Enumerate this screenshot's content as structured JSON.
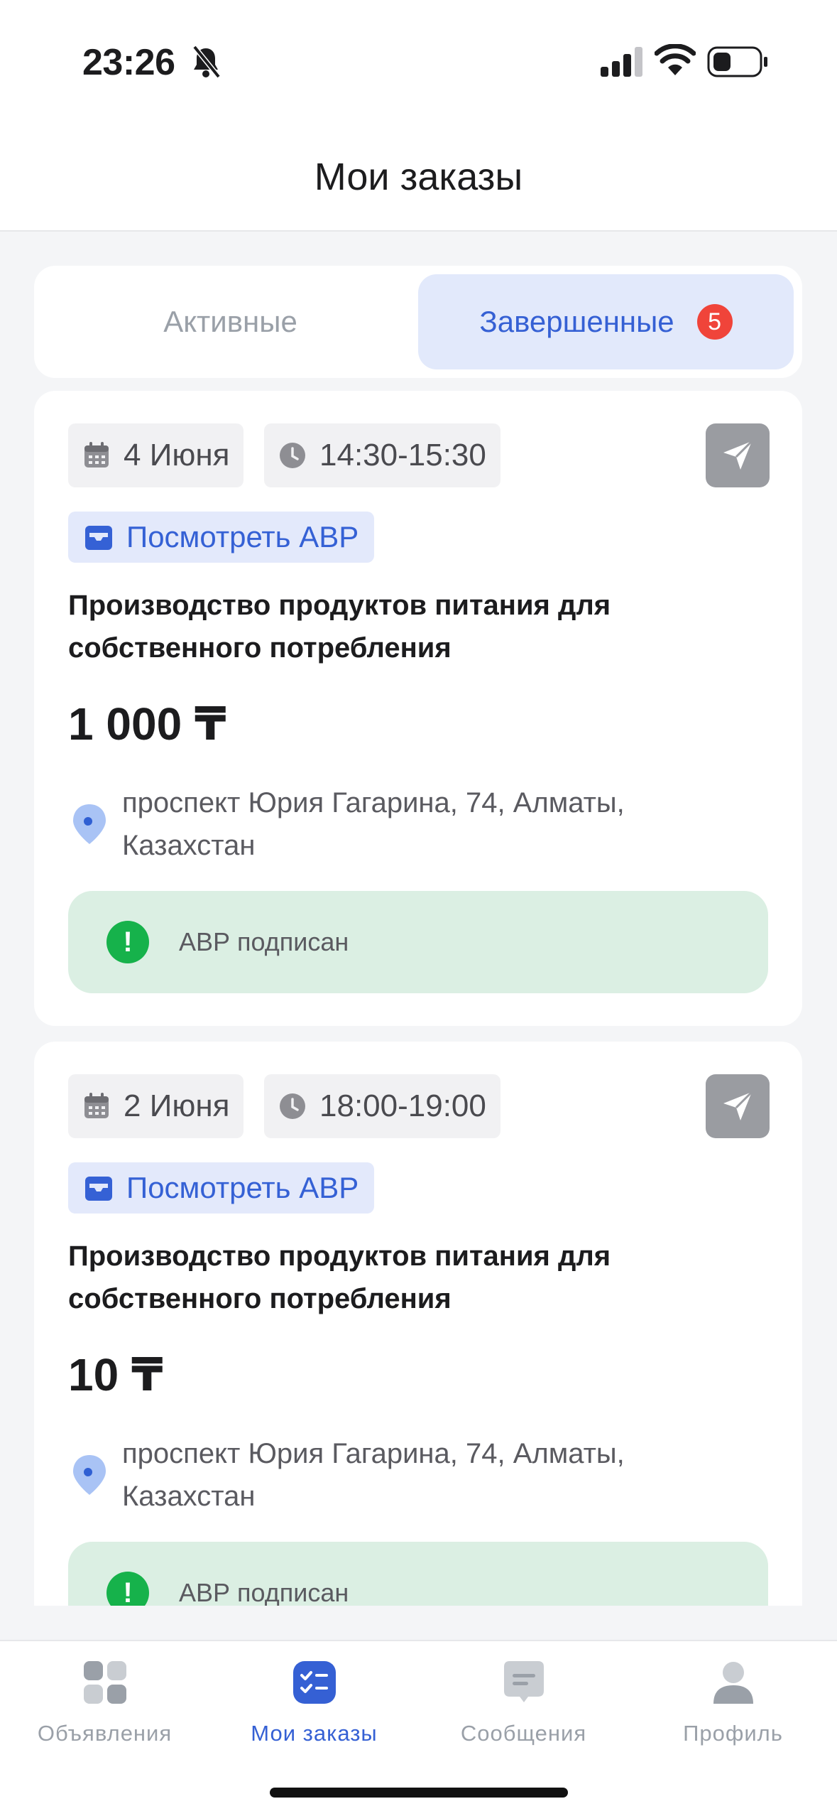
{
  "status_bar": {
    "time": "23:26"
  },
  "header": {
    "title": "Мои заказы"
  },
  "tabs": [
    {
      "label": "Активные",
      "selected": false
    },
    {
      "label": "Завершенные",
      "selected": true,
      "badge": "5"
    }
  ],
  "orders": [
    {
      "date": "4 Июня",
      "time": "14:30-15:30",
      "avr_button": "Посмотреть АВР",
      "title": "Производство продуктов питания для собственного потребления",
      "price": "1 000 ₸",
      "address": "проспект Юрия Гагарина, 74, Алматы, Казахстан",
      "status": "АВР подписан"
    },
    {
      "date": "2 Июня",
      "time": "18:00-19:00",
      "avr_button": "Посмотреть АВР",
      "title": "Производство продуктов питания для собственного потребления",
      "price": "10 ₸",
      "address": "проспект Юрия Гагарина, 74, Алматы, Казахстан",
      "status": "АВР подписан"
    }
  ],
  "bottom_nav": [
    {
      "label": "Объявления",
      "icon": "grid-icon",
      "active": false
    },
    {
      "label": "Мои заказы",
      "icon": "checklist-icon",
      "active": true
    },
    {
      "label": "Сообщения",
      "icon": "message-icon",
      "active": false
    },
    {
      "label": "Профиль",
      "icon": "profile-icon",
      "active": false
    }
  ],
  "colors": {
    "accent": "#3560d4",
    "badge": "#f0443a",
    "success": "#16b24b",
    "success_bg": "#dbefe3"
  }
}
